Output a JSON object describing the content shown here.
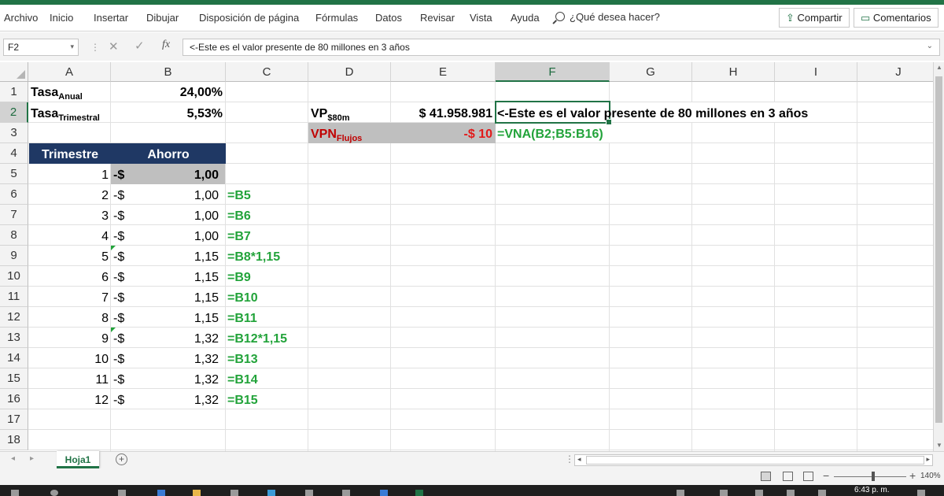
{
  "ribbon": {
    "menu": [
      "Archivo",
      "Inicio",
      "Insertar",
      "Dibujar",
      "Disposición de página",
      "Fórmulas",
      "Datos",
      "Revisar",
      "Vista",
      "Ayuda"
    ],
    "tell_me": "¿Qué desea hacer?",
    "share_label": "Compartir",
    "comments_label": "Comentarios"
  },
  "formula_bar": {
    "name_box": "F2",
    "formula": "<-Este es el valor presente de 80 millones en 3 años"
  },
  "grid": {
    "columns": [
      "A",
      "B",
      "C",
      "D",
      "E",
      "F",
      "G",
      "H",
      "I",
      "J"
    ],
    "selected_column": "F",
    "rows": [
      "1",
      "2",
      "3",
      "4",
      "5",
      "6",
      "7",
      "8",
      "9",
      "10",
      "11",
      "12",
      "13",
      "14",
      "15",
      "16",
      "17",
      "18"
    ],
    "selected_row": "2",
    "active_cell": "F2"
  },
  "cells": {
    "A1": {
      "main": "Tasa",
      "sub": "Anual"
    },
    "B1": "24,00%",
    "A2": {
      "main": "Tasa",
      "sub": "Trimestral"
    },
    "B2": "5,53%",
    "D2": {
      "main": "VP",
      "sub": "$80m"
    },
    "E2": "$ 41.958.981",
    "F2": "<-Este es el valor presente de 80 millones en 3 años",
    "D3": {
      "main": "VPN",
      "sub": "Flujos"
    },
    "E3": "-$ 10",
    "F3": "=VNA(B2;B5:B16)",
    "A4": "Trimestre",
    "B4": "Ahorro",
    "currency_symbol": "-$",
    "table": [
      {
        "trimestre": "1",
        "ahorro": "1,00",
        "formula": ""
      },
      {
        "trimestre": "2",
        "ahorro": "1,00",
        "formula": "=B5"
      },
      {
        "trimestre": "3",
        "ahorro": "1,00",
        "formula": "=B6"
      },
      {
        "trimestre": "4",
        "ahorro": "1,00",
        "formula": "=B7"
      },
      {
        "trimestre": "5",
        "ahorro": "1,15",
        "formula": "=B8*1,15"
      },
      {
        "trimestre": "6",
        "ahorro": "1,15",
        "formula": "=B9"
      },
      {
        "trimestre": "7",
        "ahorro": "1,15",
        "formula": "=B10"
      },
      {
        "trimestre": "8",
        "ahorro": "1,15",
        "formula": "=B11"
      },
      {
        "trimestre": "9",
        "ahorro": "1,32",
        "formula": "=B12*1,15"
      },
      {
        "trimestre": "10",
        "ahorro": "1,32",
        "formula": "=B13"
      },
      {
        "trimestre": "11",
        "ahorro": "1,32",
        "formula": "=B14"
      },
      {
        "trimestre": "12",
        "ahorro": "1,32",
        "formula": "=B15"
      }
    ]
  },
  "sheets": {
    "tabs": [
      "Hoja1"
    ],
    "active": "Hoja1"
  },
  "status": {
    "zoom": "140%"
  },
  "taskbar": {
    "clock": "6:43 p. m."
  },
  "colors": {
    "excel_green": "#217346",
    "formula_green": "#22a33a",
    "negative_red": "#e21a1a",
    "header_navy": "#1f3864",
    "highlight_gray": "#bfbfbf"
  }
}
